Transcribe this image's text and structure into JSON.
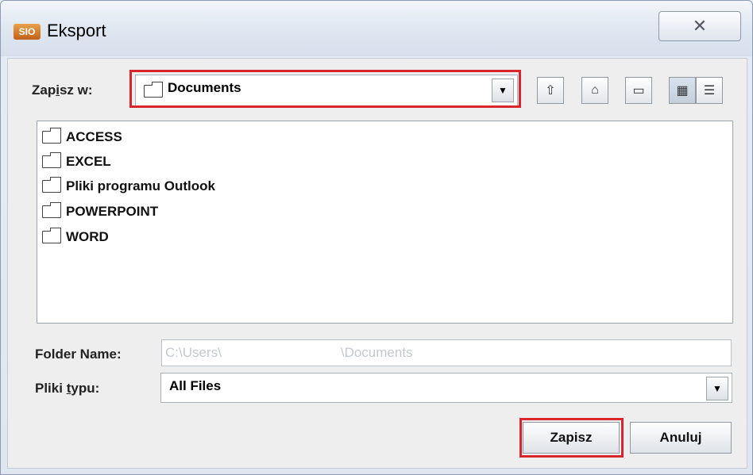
{
  "window": {
    "title": "Eksport",
    "app_icon_text": "SIO",
    "close_glyph": "✕"
  },
  "save_in": {
    "label_pre": "Zap",
    "label_mnemonic": "i",
    "label_post": "sz w:",
    "value": "Documents"
  },
  "toolbar": {
    "buttons": [
      {
        "name": "up-one-level-icon",
        "glyph": "⇧"
      },
      {
        "name": "home-icon",
        "glyph": "⌂"
      },
      {
        "name": "new-folder-icon",
        "glyph": "▭"
      },
      {
        "name": "list-view-icon",
        "glyph": "▦"
      },
      {
        "name": "details-view-icon",
        "glyph": "☰"
      }
    ]
  },
  "files": [
    "ACCESS",
    "EXCEL",
    "Pliki programu Outlook",
    "POWERPOINT",
    "WORD"
  ],
  "folder_name": {
    "label": "Folder Name:",
    "value_part1": "C:\\Users\\",
    "value_part2": "\\Documents"
  },
  "file_type": {
    "label_pre": "Pliki ",
    "label_mnemonic": "t",
    "label_post": "ypu:",
    "value": "All Files"
  },
  "buttons": {
    "save": "Zapisz",
    "cancel": "Anuluj"
  },
  "colors": {
    "highlight": "#d9252c"
  }
}
